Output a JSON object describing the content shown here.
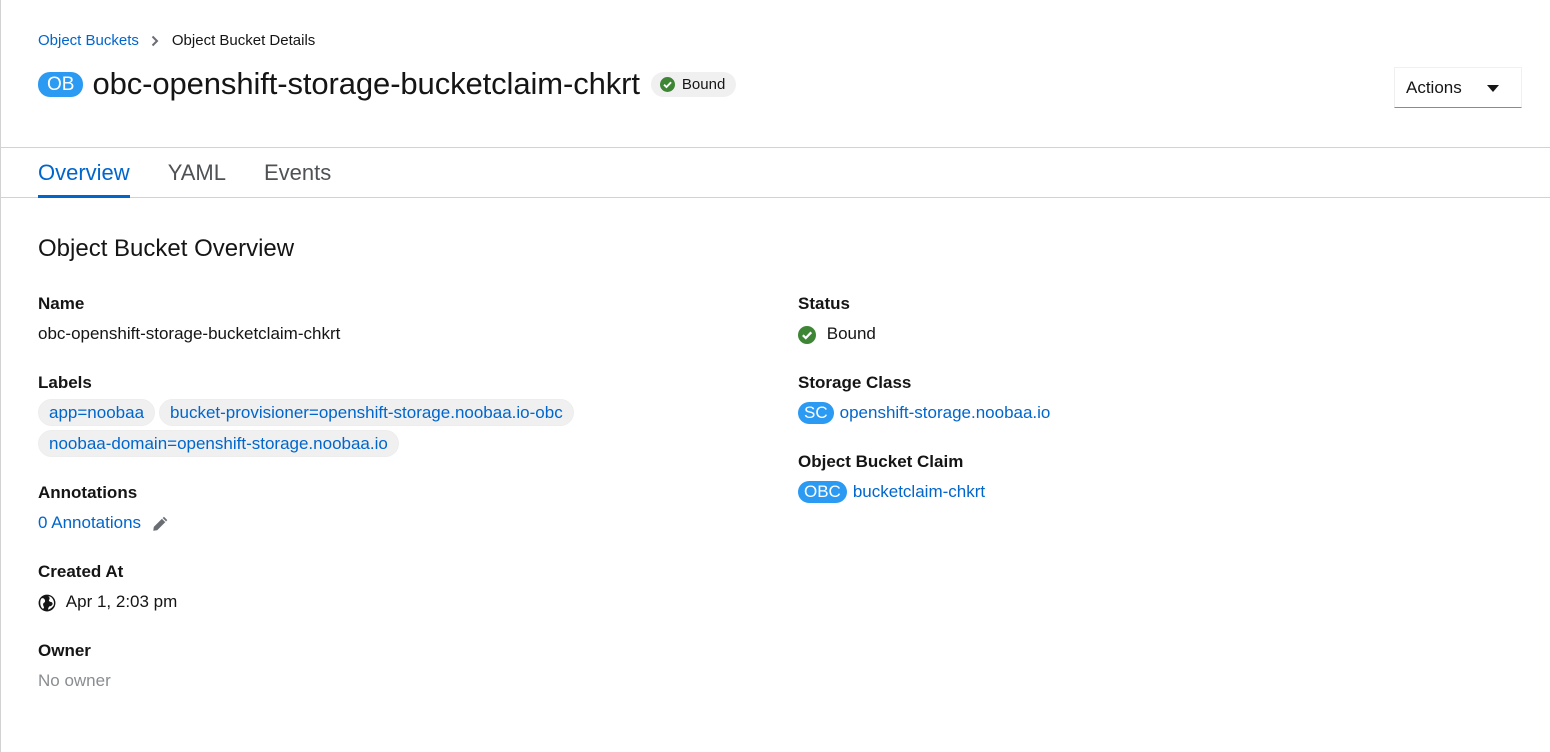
{
  "breadcrumb": {
    "parent": "Object Buckets",
    "current": "Object Bucket Details"
  },
  "header": {
    "resource_badge": "OB",
    "title": "obc-openshift-storage-bucketclaim-chkrt",
    "status": "Bound",
    "status_icon": "check-circle-icon",
    "status_color": "#3e8635",
    "actions_label": "Actions"
  },
  "tabs": [
    {
      "label": "Overview",
      "active": true
    },
    {
      "label": "YAML",
      "active": false
    },
    {
      "label": "Events",
      "active": false
    }
  ],
  "overview": {
    "section_title": "Object Bucket Overview",
    "name": {
      "label": "Name",
      "value": "obc-openshift-storage-bucketclaim-chkrt"
    },
    "labels": {
      "label": "Labels",
      "items": [
        "app=noobaa",
        "bucket-provisioner=openshift-storage.noobaa.io-obc",
        "noobaa-domain=openshift-storage.noobaa.io"
      ]
    },
    "annotations": {
      "label": "Annotations",
      "value": "0 Annotations",
      "icon": "pencil-icon"
    },
    "created_at": {
      "label": "Created At",
      "value": "Apr 1, 2:03 pm",
      "icon": "globe-icon"
    },
    "owner": {
      "label": "Owner",
      "value": "No owner"
    },
    "status": {
      "label": "Status",
      "value": "Bound",
      "icon": "check-circle-icon"
    },
    "storage_class": {
      "label": "Storage Class",
      "badge": "SC",
      "value": "openshift-storage.noobaa.io"
    },
    "object_bucket_claim": {
      "label": "Object Bucket Claim",
      "badge": "OBC",
      "value": "bucketclaim-chkrt"
    }
  },
  "colors": {
    "link": "#0066cc",
    "badge_blue": "#2b9af3",
    "success_green": "#3e8635"
  }
}
